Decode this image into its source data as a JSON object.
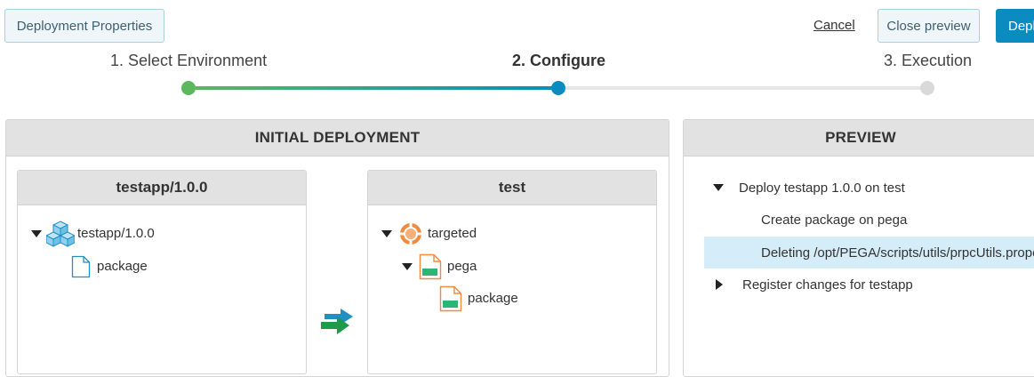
{
  "toolbar": {
    "deployment_properties": "Deployment Properties",
    "cancel": "Cancel",
    "close_preview": "Close preview",
    "deploy": "Deploy"
  },
  "stepper": {
    "steps": [
      {
        "label": "1. Select Environment",
        "state": "done"
      },
      {
        "label": "2. Configure",
        "state": "active"
      },
      {
        "label": "3. Execution",
        "state": "pending"
      }
    ],
    "colors": {
      "done": "#5cb85c",
      "active": "#0a8cc1",
      "pending": "#d9d9d9"
    }
  },
  "initial_deployment": {
    "title": "INITIAL DEPLOYMENT",
    "source": {
      "title": "testapp/1.0.0",
      "tree": {
        "app": "testapp/1.0.0",
        "child": "package"
      }
    },
    "target": {
      "title": "test",
      "tree": {
        "root": "targeted",
        "server": "pega",
        "child": "package"
      }
    }
  },
  "preview": {
    "title": "PREVIEW",
    "items": [
      {
        "label": "Deploy testapp 1.0.0 on test",
        "expanded": true
      },
      {
        "label": "Create package on pega"
      },
      {
        "label": "Deleting /opt/PEGA/scripts/utils/prpcUtils.properties",
        "selected": true
      },
      {
        "label": "Register changes for testapp",
        "expanded": false
      }
    ]
  }
}
